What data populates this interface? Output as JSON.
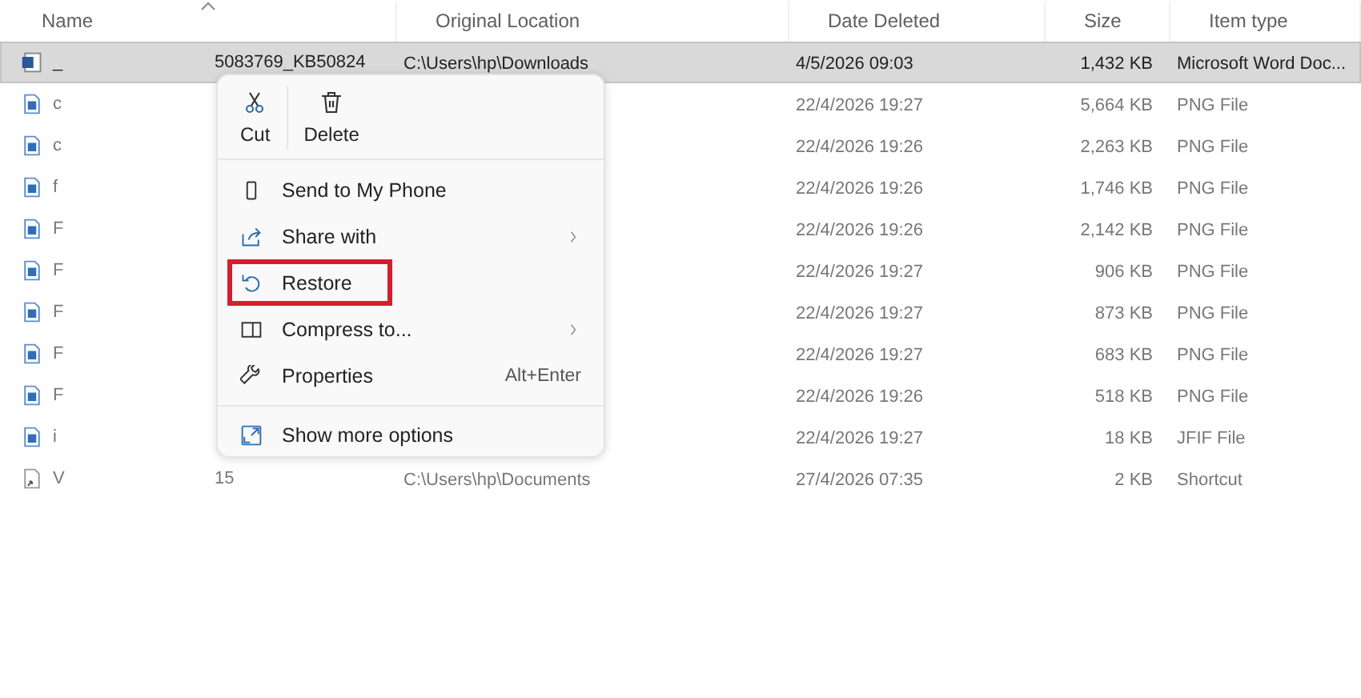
{
  "columns": [
    {
      "label": "Name",
      "sorted": true
    },
    {
      "label": "Original Location",
      "sorted": false
    },
    {
      "label": "Date Deleted",
      "sorted": false
    },
    {
      "label": "Size",
      "sorted": false
    },
    {
      "label": "Item type",
      "sorted": false
    }
  ],
  "rows": [
    {
      "kind": "word",
      "name": "_",
      "name_tail": "5083769_KB50824",
      "location": "C:\\Users\\hp\\Downloads",
      "date": "4/5/2026 09:03",
      "size": "1,432 KB",
      "type": "Microsoft Word Doc...",
      "selected": true
    },
    {
      "kind": "image",
      "name": "c",
      "date": "22/4/2026 19:27",
      "size": "5,664 KB",
      "type": "PNG File",
      "selected": false
    },
    {
      "kind": "image",
      "name": "c",
      "date": "22/4/2026 19:26",
      "size": "2,263 KB",
      "type": "PNG File",
      "selected": false
    },
    {
      "kind": "image",
      "name": "f",
      "date": "22/4/2026 19:26",
      "size": "1,746 KB",
      "type": "PNG File",
      "selected": false
    },
    {
      "kind": "image",
      "name": "F",
      "date": "22/4/2026 19:26",
      "size": "2,142 KB",
      "type": "PNG File",
      "selected": false
    },
    {
      "kind": "image",
      "name": "F",
      "date": "22/4/2026 19:27",
      "size": "906 KB",
      "type": "PNG File",
      "selected": false
    },
    {
      "kind": "image",
      "name": "F",
      "date": "22/4/2026 19:27",
      "size": "873 KB",
      "type": "PNG File",
      "selected": false
    },
    {
      "kind": "image",
      "name": "F",
      "date": "22/4/2026 19:27",
      "size": "683 KB",
      "type": "PNG File",
      "selected": false
    },
    {
      "kind": "image",
      "name": "F",
      "date": "22/4/2026 19:26",
      "size": "518 KB",
      "type": "PNG File",
      "selected": false
    },
    {
      "kind": "image",
      "name": "i",
      "date": "22/4/2026 19:27",
      "size": "18 KB",
      "type": "JFIF File",
      "selected": false
    },
    {
      "kind": "shortcut",
      "name": "V",
      "name_tail": "15",
      "location": "C:\\Users\\hp\\Documents",
      "date": "27/4/2026 07:35",
      "size": "2 KB",
      "type": "Shortcut",
      "selected": false
    }
  ],
  "context_menu": {
    "actions": [
      {
        "kind": "cut",
        "label": "Cut"
      },
      {
        "kind": "delete",
        "label": "Delete"
      }
    ],
    "items": [
      {
        "kind": "phone",
        "label": "Send to My Phone",
        "submenu": false,
        "highlighted": false
      },
      {
        "kind": "share",
        "label": "Share with",
        "submenu": true,
        "highlighted": false
      },
      {
        "kind": "restore",
        "label": "Restore",
        "submenu": false,
        "highlighted": true
      },
      {
        "kind": "compress",
        "label": "Compress to...",
        "submenu": true,
        "highlighted": false
      },
      {
        "kind": "properties",
        "label": "Properties",
        "shortcut": "Alt+Enter",
        "submenu": false,
        "highlighted": false
      }
    ],
    "footer": {
      "kind": "more",
      "label": "Show more options"
    }
  }
}
